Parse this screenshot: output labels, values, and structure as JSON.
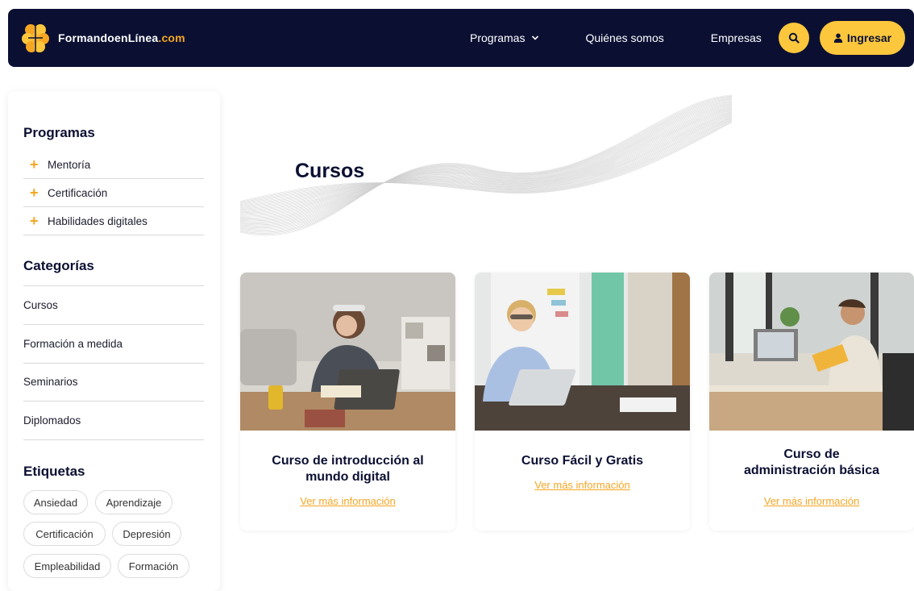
{
  "header": {
    "logo_main": "FormandoenLínea",
    "logo_domain": ".com",
    "nav": {
      "programas": "Programas",
      "quienes": "Quiénes somos",
      "empresas": "Empresas"
    },
    "login_label": "Ingresar",
    "colors": {
      "bg": "#0b1033",
      "accent": "#fcc73c",
      "orange": "#f5a623"
    }
  },
  "sidebar": {
    "programas_title": "Programas",
    "programas": [
      "Mentoría",
      "Certificación",
      "Habilidades digitales"
    ],
    "categorias_title": "Categorías",
    "categorias": [
      "Cursos",
      "Formación a medida",
      "Seminarios",
      "Diplomados"
    ],
    "etiquetas_title": "Etiquetas",
    "etiquetas": [
      "Ansiedad",
      "Aprendizaje",
      "Certificación",
      "Depresión",
      "Empleabilidad",
      "Formación"
    ]
  },
  "main": {
    "title": "Cursos",
    "cards": [
      {
        "title_lines": [
          "Curso de introducción al",
          "mundo digital"
        ],
        "link": "Ver más información"
      },
      {
        "title_lines": [
          "Curso Fácil y Gratis"
        ],
        "link": "Ver más información"
      },
      {
        "title_lines": [
          "Curso de",
          "administración básica"
        ],
        "link": "Ver más información"
      }
    ]
  },
  "icons": {
    "logo": "brain-icon",
    "dropdown": "chevron-down-icon",
    "search": "search-icon",
    "user": "user-icon",
    "plus": "plus-icon"
  }
}
